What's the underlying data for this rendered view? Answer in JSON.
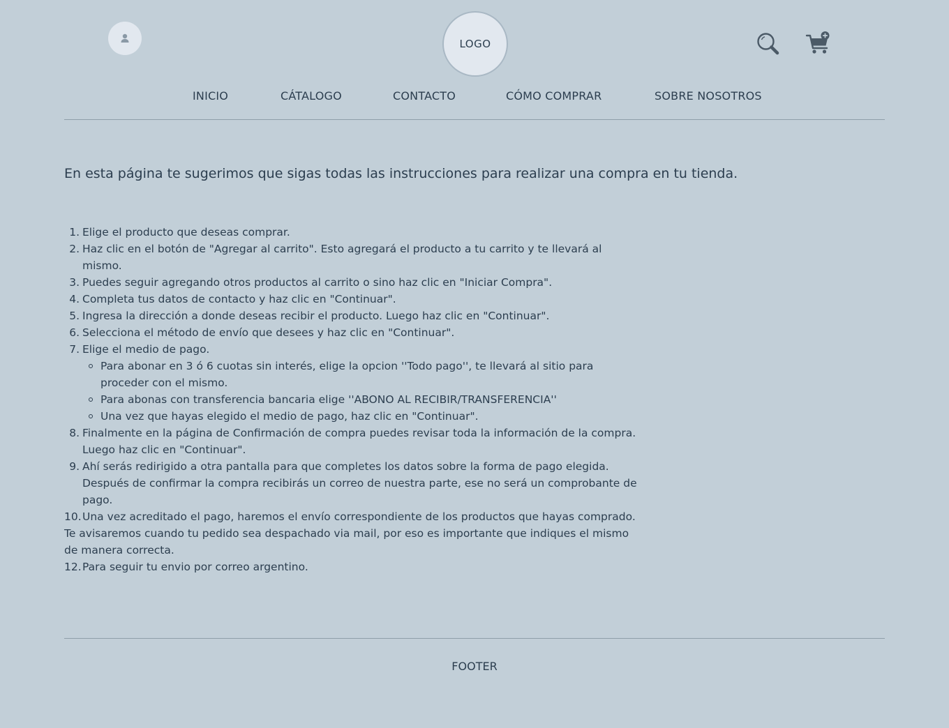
{
  "header": {
    "logo_text": "LOGO",
    "user_icon": "user-icon",
    "search_icon": "search-icon",
    "cart_icon": "cart-icon"
  },
  "nav": {
    "items": [
      "INICIO",
      "CÁTALOGO",
      "CONTACTO",
      "CÓMO COMPRAR",
      "SOBRE NOSOTROS"
    ]
  },
  "main": {
    "intro": "En esta página te sugerimos que sigas todas las instrucciones para realizar una compra en tu tienda.",
    "steps": [
      {
        "num": "1.",
        "text": "Elige el producto que deseas comprar."
      },
      {
        "num": "2.",
        "text": "Haz clic en el botón de \"Agregar al carrito\". Esto agregará el producto a tu carrito y te llevará al mismo."
      },
      {
        "num": "3.",
        "text": "Puedes seguir agregando otros productos al carrito o sino haz clic en \"Iniciar Compra\"."
      },
      {
        "num": "4.",
        "text": "Completa tus datos de contacto y haz clic en \"Continuar\"."
      },
      {
        "num": "5.",
        "text": "Ingresa la dirección a donde deseas recibir el producto. Luego haz clic en \"Continuar\"."
      },
      {
        "num": "6.",
        "text": "Selecciona el método de envío que desees y haz clic en \"Continuar\"."
      },
      {
        "num": "7.",
        "text": "Elige el medio de pago."
      }
    ],
    "payment_bullets": [
      "Para abonar en 3 ó 6 cuotas sin interés, elige la opcion ''Todo pago'', te llevará al sitio para proceder con el mismo.",
      "Para abonas con transferencia bancaria elige ''ABONO AL RECIBIR/TRANSFERENCIA''",
      "Una vez que hayas elegido el medio de pago, haz clic en \"Continuar\"."
    ],
    "steps_after": [
      {
        "num": "8.",
        "text": "Finalmente en la página de Confirmación de compra puedes revisar toda la información de la compra. Luego haz clic en \"Continuar\"."
      },
      {
        "num": "9.",
        "text": "Ahí serás redirigido a otra pantalla para que completes los datos sobre la forma de pago elegida. Después de confirmar la compra recibirás un correo de nuestra parte, ese no será un comprobante de pago."
      },
      {
        "num": "10.",
        "text": "Una vez acreditado el pago, haremos el envío correspondiente de los productos que hayas comprado."
      }
    ],
    "note": "Te avisaremos cuando tu pedido sea despachado via mail, por eso es importante que indiques el mismo de manera correcta.",
    "last_step": {
      "num": "12.",
      "text": "Para seguir tu envio por correo argentino."
    }
  },
  "footer": {
    "text": "FOOTER"
  }
}
